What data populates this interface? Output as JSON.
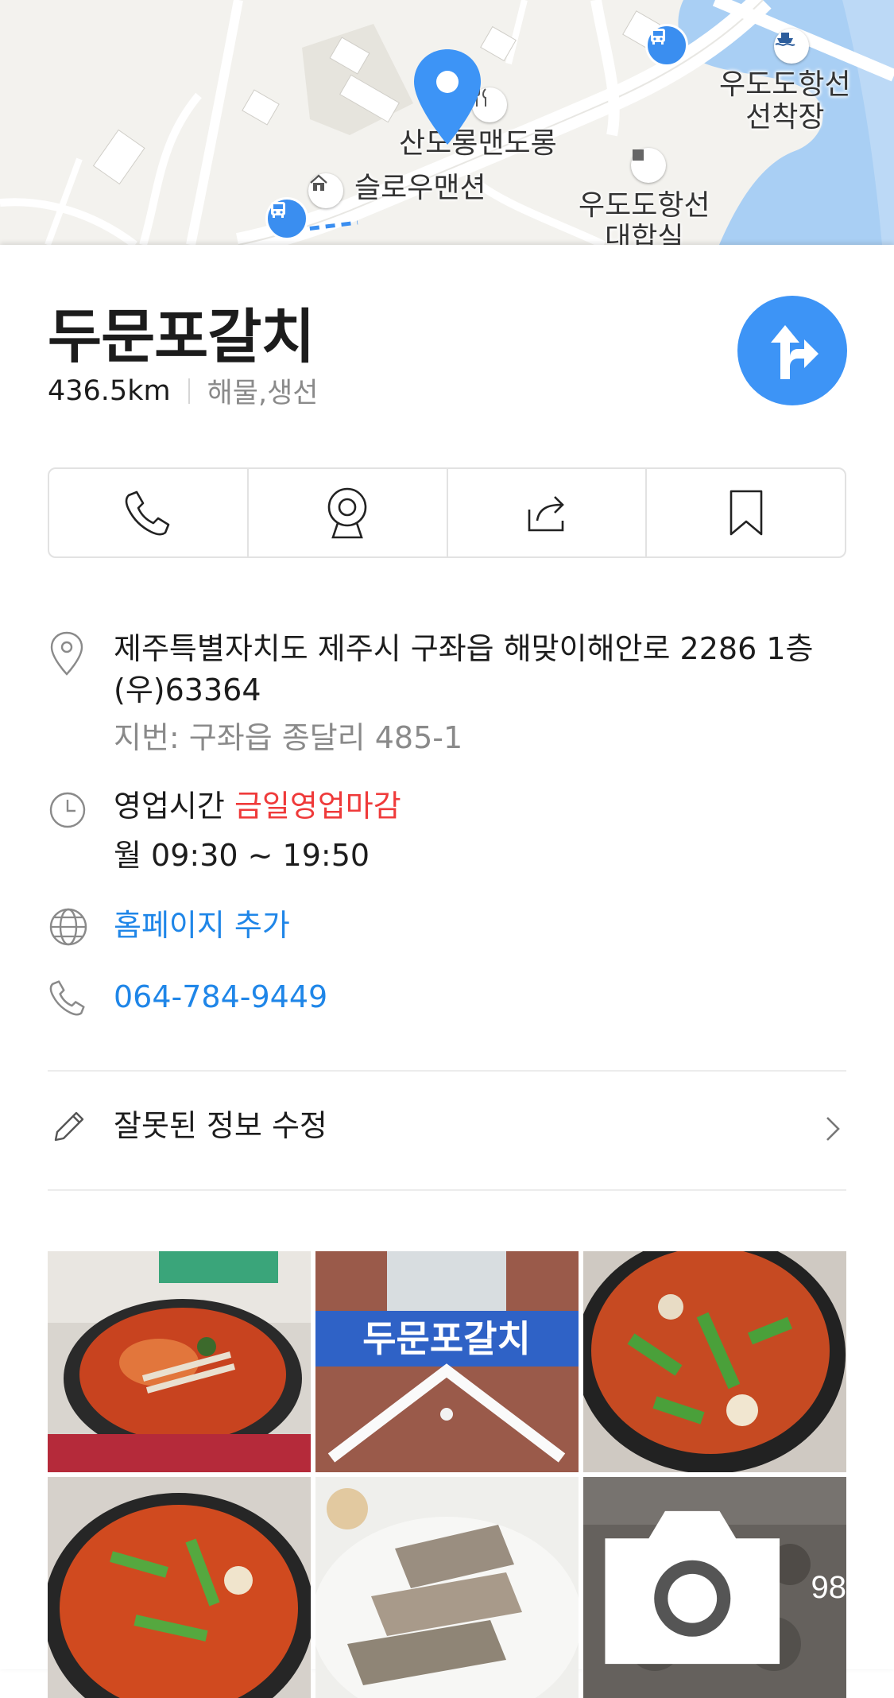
{
  "map": {
    "labels": {
      "port": "우도도항선\n선착장",
      "restaurant_poi": "산도롱맨도롱",
      "pension": "슬로우맨션",
      "ferry_office": "우도도항선\n대합실"
    }
  },
  "place": {
    "name": "두문포갈치",
    "distance": "436.5km",
    "category": "해물,생선"
  },
  "info": {
    "address": "제주특별자치도 제주시 구좌읍 해맞이해안로 2286 1층",
    "postal": "(우)63364",
    "lot_address": "지번: 구좌읍 종달리 485-1",
    "hours_label": "영업시간",
    "hours_status": "금일영업마감",
    "hours_today": "월 09:30 ~ 19:50",
    "homepage": "홈페이지 추가",
    "phone": "064-784-9449"
  },
  "edit": {
    "label": "잘못된 정보 수정"
  },
  "photos": {
    "sign_text": "두문포갈치",
    "more_count": "98"
  },
  "colors": {
    "accent": "#3d94f6",
    "link": "#1f86e8",
    "closed": "#ef3a3a"
  }
}
